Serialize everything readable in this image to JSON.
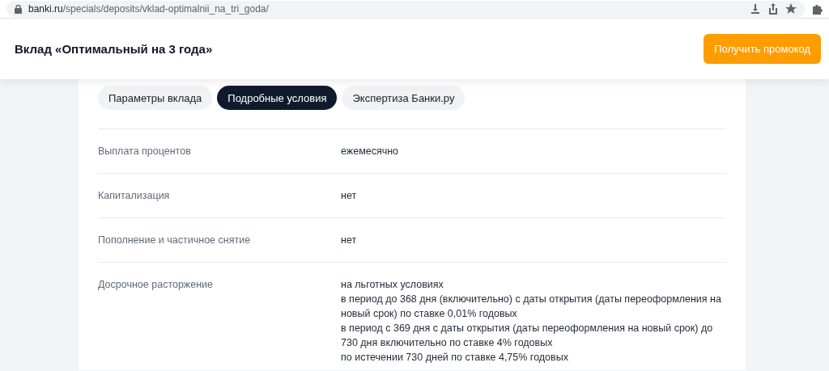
{
  "browser": {
    "url_host": "banki.ru",
    "url_path": "/specials/deposits/vklad-optimalnii_na_tri_goda/"
  },
  "header": {
    "title": "Вклад «Оптимальный на 3 года»",
    "button": "Получить промокод"
  },
  "tabs": [
    {
      "label": "Параметры вклада",
      "selected": false
    },
    {
      "label": "Подробные условия",
      "selected": true
    },
    {
      "label": "Экспертиза Банки.ру",
      "selected": false
    }
  ],
  "rows": [
    {
      "label": "Выплата процентов",
      "values": [
        "ежемесячно"
      ]
    },
    {
      "label": "Капитализация",
      "values": [
        "нет"
      ]
    },
    {
      "label": "Пополнение и частичное снятие",
      "values": [
        "нет"
      ]
    },
    {
      "label": "Досрочное расторжение",
      "values": [
        "на льготных условиях",
        "в период до 368 дня (включительно) с даты открытия (даты переоформления на новый срок) по ставке 0,01% годовых",
        "в период с 369 дня с даты открытия (даты переоформления на новый срок) до 730 дня включительно по ставке 4% годовых",
        "по истечении 730 дней по ставке 4,75% годовых"
      ]
    }
  ]
}
